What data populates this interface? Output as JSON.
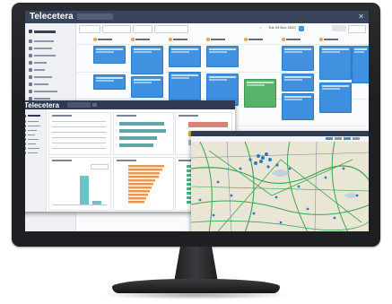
{
  "scheduler": {
    "app_name": "Telecetera",
    "toolbar": {
      "date_label": "Tue 29 Nov 2022"
    }
  },
  "dashboard": {
    "app_name": "Telecetera"
  },
  "icons": {
    "close": "close-icon",
    "calendar": "calendar-icon",
    "map_marker": "map-marker-icon"
  },
  "colors": {
    "frame": "#1e1f22",
    "header": "#2f3b52",
    "appointment_blue": "#3d8fe0",
    "appointment_green": "#57b36a",
    "chart_teal": "#5fa8a8",
    "chart_salmon": "#e07f73",
    "chart_olive": "#c2b23d",
    "chart_lavender": "#a9b7e8",
    "chart_orange": "#e8964f",
    "map_route_green": "#3aa64f"
  }
}
